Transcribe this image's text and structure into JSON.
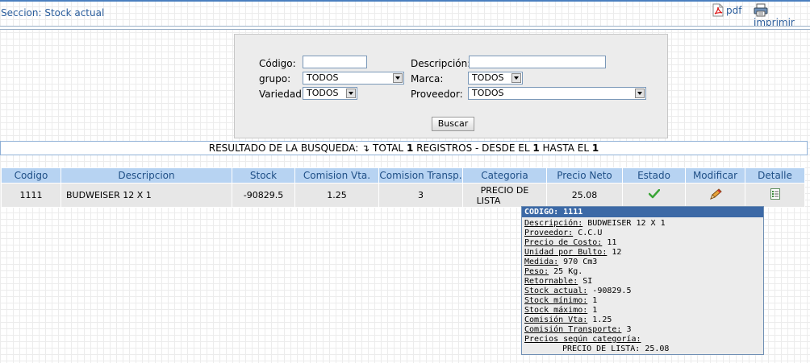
{
  "header": {
    "title": "Seccion: Stock actual",
    "pdf_label": "pdf",
    "print_label": "imprimir"
  },
  "search": {
    "codigo_label": "Código:",
    "codigo_value": "",
    "descripcion_label": "Descripción:",
    "descripcion_value": "",
    "grupo_label": "grupo:",
    "grupo_value": "TODOS",
    "marca_label": "Marca:",
    "marca_value": "TODOS",
    "variedad_label": "Variedad:",
    "variedad_value": "TODOS",
    "proveedor_label": "Proveedor:",
    "proveedor_value": "TODOS",
    "button_label": "Buscar"
  },
  "result": {
    "prefix": "RESULTADO DE LA BUSQUEDA: ",
    "arrow": "↴",
    "total_text": " TOTAL ",
    "total": "1",
    "registros_text": " REGISTROS - DESDE EL ",
    "from": "1",
    "hasta_text": " HASTA EL ",
    "to": "1"
  },
  "table": {
    "headers": [
      "Codigo",
      "Descripcion",
      "Stock",
      "Comision Vta.",
      "Comision Transp.",
      "Categoria",
      "Precio Neto",
      "Estado",
      "Modificar",
      "Detalle"
    ],
    "rows": [
      {
        "codigo": "1111",
        "descripcion": "BUDWEISER 12 X 1",
        "stock": "-90829.5",
        "comision_vta": "1.25",
        "comision_transp": "3",
        "categoria_line1": "PRECIO DE",
        "categoria_line2": "LISTA",
        "precio_neto": "25.08",
        "estado_icon": "check-icon",
        "modificar_icon": "pencil-icon",
        "detalle_icon": "list-icon"
      }
    ]
  },
  "tooltip": {
    "title": "CODIGO: 1111",
    "fields": [
      {
        "key": "Descripción:",
        "value": " BUDWEISER 12 X 1"
      },
      {
        "key": "Proveedor:",
        "value": " C.C.U"
      },
      {
        "key": "Precio de Costo:",
        "value": " 11"
      },
      {
        "key": "Unidad por Bulto:",
        "value": " 12"
      },
      {
        "key": "Medida:",
        "value": " 970 Cm3"
      },
      {
        "key": "Peso:",
        "value": " 25 Kg."
      },
      {
        "key": "Retornable:",
        "value": " SI"
      },
      {
        "key": "Stock actual:",
        "value": " -90829.5"
      },
      {
        "key": "Stock mínimo:",
        "value": " 1"
      },
      {
        "key": "Stock máximo:",
        "value": " 1"
      },
      {
        "key": "Comisión Vta:",
        "value": " 1.25"
      },
      {
        "key": "Comisión Transporte:",
        "value": " 3"
      },
      {
        "key": "Precios según categoría:",
        "value": ""
      }
    ],
    "price_line": "PRECIO DE LISTA: 25.08"
  },
  "colors": {
    "accent": "#2a5d9c",
    "table_header_bg": "#b7d3f2",
    "tooltip_header_bg": "#3c69a6",
    "check_green": "#3aa537"
  }
}
